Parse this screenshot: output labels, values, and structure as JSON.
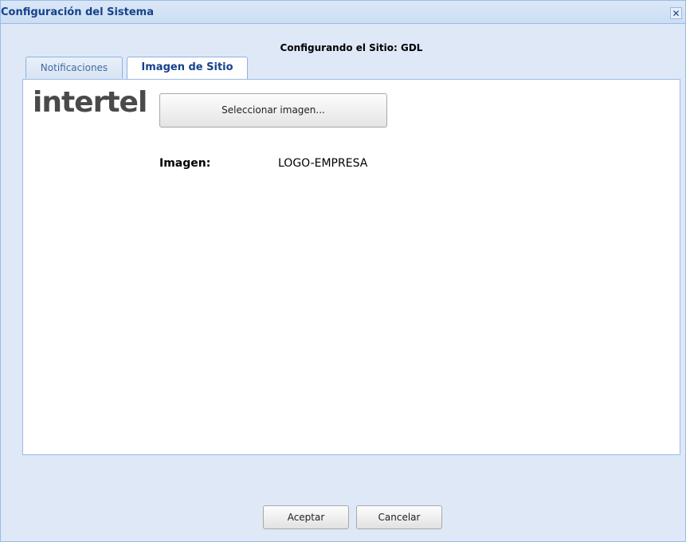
{
  "window": {
    "title": "Configuración del Sistema",
    "close_glyph": "✕"
  },
  "subtitle": "Configurando el Sitio: GDL",
  "tabs": [
    {
      "label": "Notificaciones",
      "active": false
    },
    {
      "label": "Imagen de Sitio",
      "active": true
    }
  ],
  "panel": {
    "logo_text": "intertel",
    "select_button_label": "Seleccionar imagen...",
    "image_label": "Imagen:",
    "image_value": "LOGO-EMPRESA"
  },
  "footer": {
    "accept_label": "Aceptar",
    "cancel_label": "Cancelar"
  },
  "colors": {
    "title_text": "#15428b",
    "frame_bg": "#dfe8f6",
    "border": "#99bbe8",
    "logo_accent": "#e07020"
  }
}
